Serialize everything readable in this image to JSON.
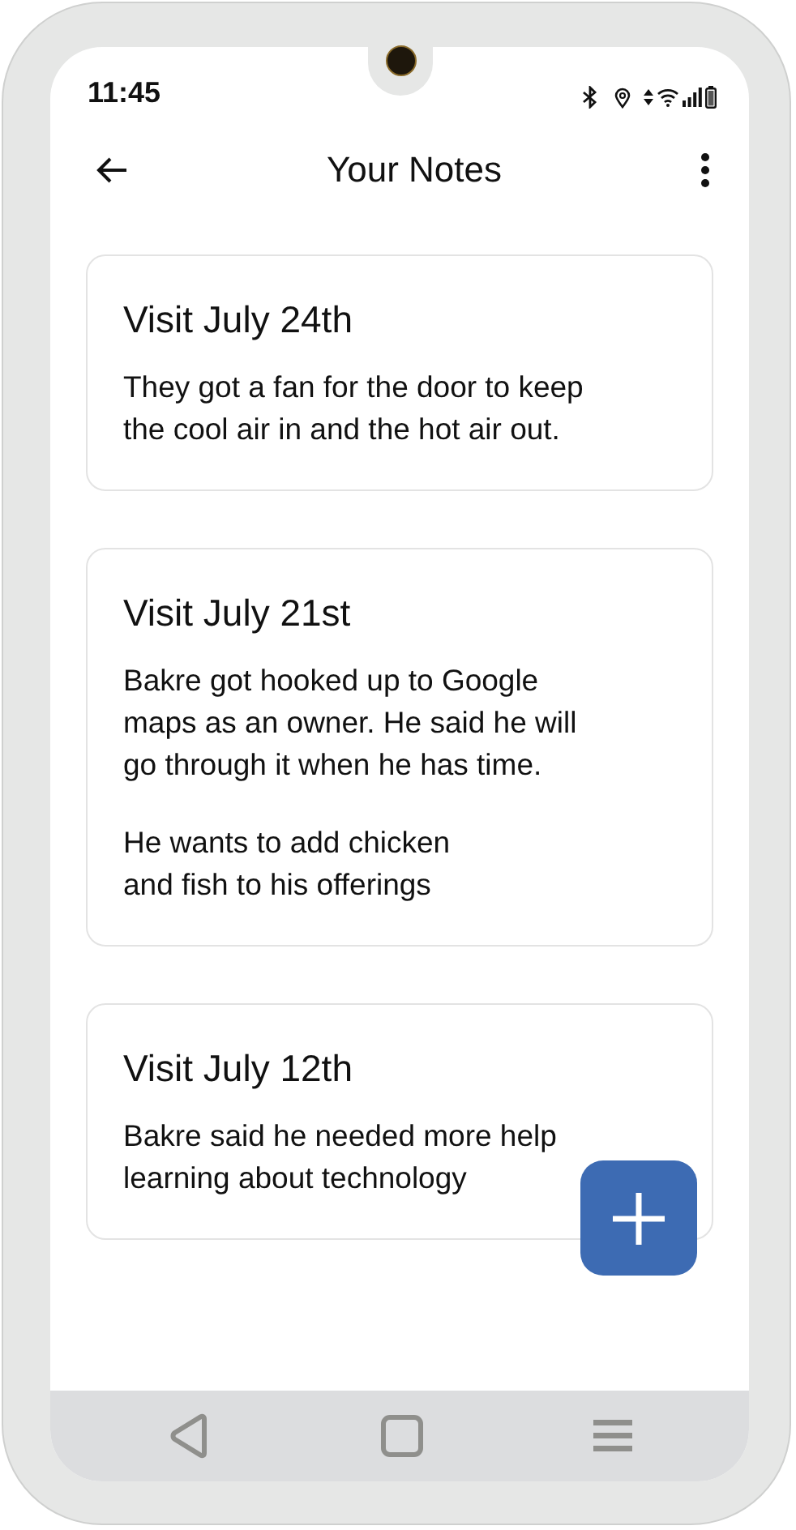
{
  "status_bar": {
    "time": "11:45"
  },
  "app_bar": {
    "title": "Your Notes"
  },
  "notes": [
    {
      "title": "Visit July 24th",
      "paragraphs": [
        "They got a fan for the door to keep\nthe cool air in and the hot air out."
      ]
    },
    {
      "title": "Visit July 21st",
      "paragraphs": [
        "Bakre got hooked up to Google\nmaps as an owner. He said he will\ngo through it when he has time.",
        "He wants to add chicken\nand fish to his offerings"
      ]
    },
    {
      "title": "Visit July 12th",
      "paragraphs": [
        "Bakre said he needed more help\nlearning about technology"
      ]
    }
  ]
}
